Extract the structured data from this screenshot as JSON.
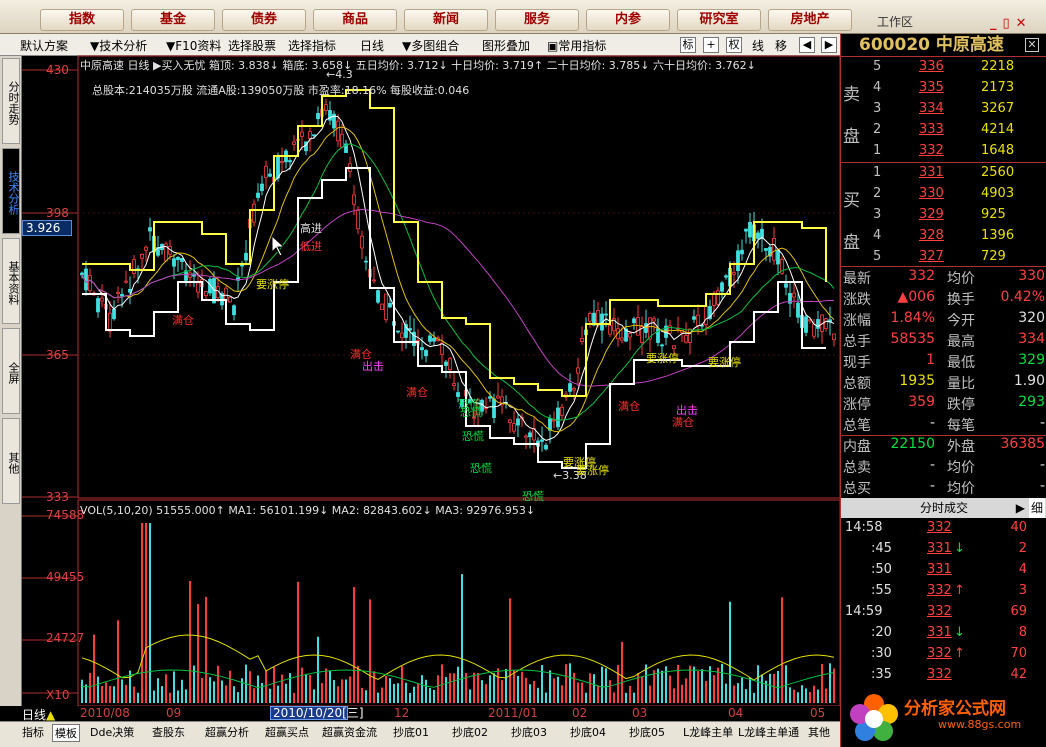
{
  "topnav": [
    "指数",
    "基金",
    "债券",
    "商品",
    "新闻",
    "服务",
    "内参",
    "研究室",
    "房地产"
  ],
  "workarea": "工作区",
  "toolbar": {
    "items": [
      "默认方案",
      "技术分析",
      "F10资料",
      "选择股票",
      "选择指标",
      "日线",
      "多图组合",
      "图形叠加",
      "常用指标"
    ],
    "right": [
      "标",
      "权",
      "线",
      "移"
    ]
  },
  "lefttabs": [
    "分时走势",
    "技术分析",
    "基本资料",
    "全屏",
    "其他"
  ],
  "chart": {
    "stock_name": "中原高速",
    "period": "日线",
    "info1": "中原高速 日线 ▶买入无忧 箱顶: 3.838↓ 箱底: 3.658↓ 五日均价: 3.712↓ 十日均价: 3.719↑ 二十日均价: 3.785↓ 六十日均价: 3.762↓",
    "info2": "总股本:214035万股 流通A股:139050万股 市盈率:18.16% 每股收益:0.046",
    "vol": "VOL(5,10,20) 51555.000↑ MA1: 56101.199↓ MA2: 82843.602↓ MA3: 92976.953↓",
    "yaxis": [
      "430",
      "398",
      "365",
      "333"
    ],
    "current_price": "3.926",
    "vol_axis": [
      "74588",
      "49455",
      "24727",
      "X10"
    ],
    "high_label": "4.3",
    "low_label": "3.38",
    "annotations": [
      "要涨停",
      "满仓",
      "高进",
      "低进",
      "满仓",
      "出击",
      "满仓",
      "恐慌",
      "恐慌",
      "恐慌",
      "恐慌",
      "要涨停",
      "要涨停",
      "要涨停",
      "要涨停",
      "满仓",
      "出击",
      "满仓",
      "要涨停",
      "恐慌"
    ],
    "xaxis": [
      "2010/08",
      "09",
      "10",
      "12",
      "2011/01",
      "02",
      "03",
      "04",
      "05"
    ],
    "datebox": "2010/10/20[三]",
    "dayline": "日线"
  },
  "bottomtabs": [
    "指标",
    "模板",
    "Dde决策",
    "查股东",
    "超赢分析",
    "超赢买点",
    "超赢资金流",
    "抄底01",
    "抄底02",
    "抄底03",
    "抄底04",
    "抄底05",
    "L龙峰主单",
    "L龙峰主单通",
    "其他"
  ],
  "quote": {
    "code": "600020",
    "name": "中原高速",
    "sell": [
      [
        "5",
        "336",
        "2218"
      ],
      [
        "4",
        "335",
        "2173"
      ],
      [
        "3",
        "334",
        "3267"
      ],
      [
        "2",
        "333",
        "4214"
      ],
      [
        "1",
        "332",
        "1648"
      ]
    ],
    "buy": [
      [
        "1",
        "331",
        "2560"
      ],
      [
        "2",
        "330",
        "4903"
      ],
      [
        "3",
        "329",
        "925"
      ],
      [
        "4",
        "328",
        "1396"
      ],
      [
        "5",
        "327",
        "729"
      ]
    ],
    "sell_side": [
      "卖",
      "盘"
    ],
    "buy_side": [
      "买",
      "盘"
    ],
    "stats": [
      [
        "最新",
        "332",
        "均价",
        "330"
      ],
      [
        "涨跌",
        "▲006",
        "换手",
        "0.42%"
      ],
      [
        "涨幅",
        "1.84%",
        "今开",
        "320"
      ],
      [
        "总手",
        "58535",
        "最高",
        "334"
      ],
      [
        "现手",
        "1",
        "最低",
        "329"
      ],
      [
        "总额",
        "1935",
        "量比",
        "1.90"
      ],
      [
        "涨停",
        "359",
        "跌停",
        "293"
      ],
      [
        "总笔",
        "-",
        "每笔",
        "-"
      ],
      [
        "内盘",
        "22150",
        "外盘",
        "36385"
      ],
      [
        "总卖",
        "-",
        "均价",
        "-"
      ],
      [
        "总买",
        "-",
        "均价",
        "-"
      ]
    ],
    "trade_header": "分时成交",
    "trades": [
      [
        "14:58",
        "332",
        "",
        "40"
      ],
      [
        ":45",
        "331",
        "↓",
        "2"
      ],
      [
        ":50",
        "331",
        "",
        "4"
      ],
      [
        ":55",
        "332",
        "↑",
        "3"
      ],
      [
        "14:59",
        "332",
        "",
        "69"
      ],
      [
        ":20",
        "331",
        "↓",
        "8"
      ],
      [
        ":30",
        "332",
        "↑",
        "70"
      ],
      [
        ":35",
        "332",
        "",
        "42"
      ]
    ]
  },
  "logo": {
    "text": "分析家公式网",
    "url": "www.88gs.com"
  }
}
